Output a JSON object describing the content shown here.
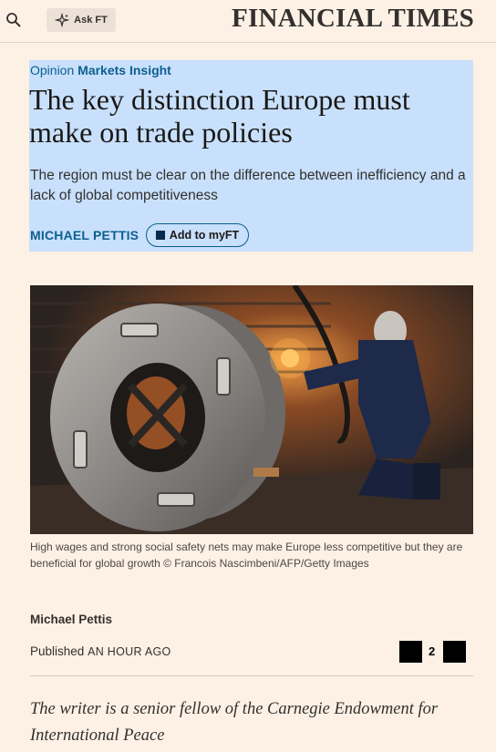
{
  "header": {
    "ask_label": "Ask FT",
    "brand": "FINANCIAL TIMES"
  },
  "article": {
    "section": "Opinion",
    "series": "Markets Insight",
    "headline": "The key distinction Europe must make on trade policies",
    "standfirst": "The region must be clear on the difference between inefficiency and a lack of global competitiveness",
    "author_upper": "MICHAEL PETTIS",
    "add_myft_label": "Add to myFT",
    "caption": "High wages and strong social safety nets may make Europe less competitive but they are beneficial for global growth © Francois Nascimbeni/AFP/Getty Images",
    "byline_name": "Michael Pettis",
    "published_label": "Published",
    "published_time": "AN HOUR AGO",
    "share_count": "2",
    "author_note": "The writer is a senior fellow of the Carnegie Endowment for International Peace"
  },
  "colors": {
    "background": "#fdf1e5",
    "highlight": "#c8e0fb",
    "link": "#0d5f91"
  }
}
